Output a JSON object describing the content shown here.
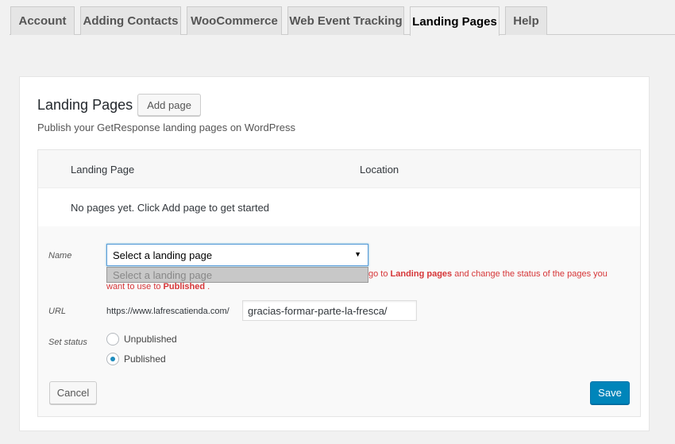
{
  "tabs": [
    {
      "label": "Account",
      "active": false
    },
    {
      "label": "Adding Contacts",
      "active": false
    },
    {
      "label": "WooCommerce",
      "active": false
    },
    {
      "label": "Web Event Tracking",
      "active": false
    },
    {
      "label": "Landing Pages",
      "active": true
    },
    {
      "label": "Help",
      "active": false
    }
  ],
  "card": {
    "title": "Landing Pages",
    "add_button": "Add page",
    "subtitle": "Publish your GetResponse landing pages on WordPress"
  },
  "table": {
    "columns": [
      "Landing Page",
      "Location"
    ],
    "empty_message": "No pages yet. Click Add page to get started"
  },
  "form": {
    "name_label": "Name",
    "select_value": "Select a landing page",
    "dropdown_option": "Select a landing page",
    "notice": {
      "part1": "go to ",
      "link1": "Landing pages",
      "part2": " and change the status of the pages you",
      "part3": "want to use to ",
      "link2": "Published",
      "part4": " ."
    },
    "url_label": "URL",
    "url_prefix": "https://www.lafrescatienda.com/",
    "url_value": "gracias-formar-parte-la-fresca/",
    "status_label": "Set status",
    "status_options": [
      {
        "label": "Unpublished",
        "checked": false
      },
      {
        "label": "Published",
        "checked": true
      }
    ],
    "cancel_button": "Cancel",
    "save_button": "Save"
  },
  "colors": {
    "primary": "#0085ba",
    "error": "#d63638",
    "background": "#f1f1f1"
  }
}
